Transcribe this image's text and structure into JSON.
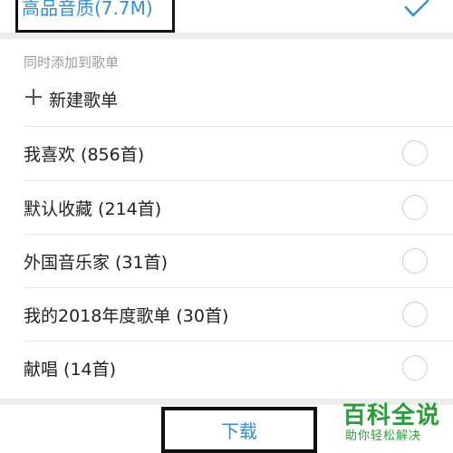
{
  "quality": {
    "label": "高品音质(7.7M)",
    "selected": true,
    "accent_color": "#2e8fe6"
  },
  "check_icon": "checkmark-icon",
  "section": {
    "header": "同时添加到歌单"
  },
  "new_playlist": {
    "icon": "plus-icon",
    "label": "新建歌单"
  },
  "playlists": [
    {
      "label": "我喜欢 (856首)",
      "checked": false
    },
    {
      "label": "默认收藏 (214首)",
      "checked": false
    },
    {
      "label": "外国音乐家 (31首)",
      "checked": false
    },
    {
      "label": "我的2018年度歌单 (30首)",
      "checked": false
    },
    {
      "label": "献唱 (14首)",
      "checked": false
    }
  ],
  "download": {
    "label": "下载"
  },
  "watermark": {
    "title": "百科全说",
    "subtitle": "助你轻松解决",
    "color": "#2a9d3a"
  }
}
